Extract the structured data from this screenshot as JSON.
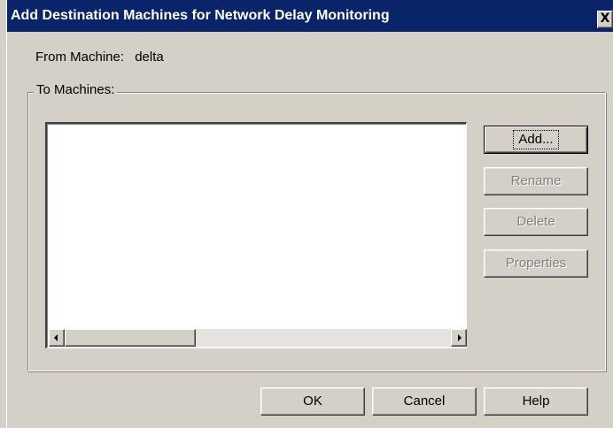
{
  "window": {
    "title": "Add Destination Machines for Network Delay Monitoring",
    "close_label": "X"
  },
  "from_machine": {
    "label": "From Machine:",
    "value": "delta"
  },
  "to_machines": {
    "group_label": "To Machines:",
    "items": []
  },
  "side_buttons": {
    "add": "Add...",
    "rename": "Rename",
    "delete": "Delete",
    "properties": "Properties"
  },
  "footer_buttons": {
    "ok": "OK",
    "cancel": "Cancel",
    "help": "Help"
  },
  "colors": {
    "titlebar": "#0a246a",
    "face": "#d4d0c8",
    "disabled_text": "#808080"
  }
}
